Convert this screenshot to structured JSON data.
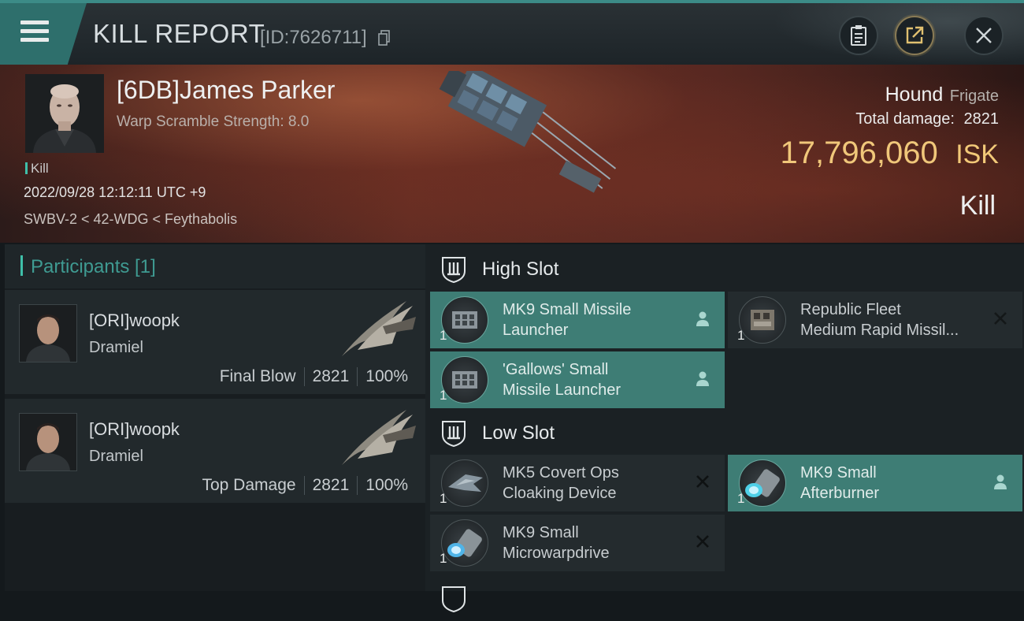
{
  "header": {
    "title": "KILL REPORT",
    "report_id": "[ID:7626711]"
  },
  "victim": {
    "name": "[6DB]James Parker",
    "warp_scramble": "Warp Scramble Strength: 8.0",
    "tag": "Kill",
    "datetime": "2022/09/28 12:12:11 UTC +9",
    "location": "SWBV-2 < 42-WDG < Feythabolis",
    "ship_name": "Hound",
    "ship_class": "Frigate",
    "damage_label": "Total damage:",
    "damage_value": "2821",
    "isk_value": "17,796,060",
    "isk_unit": "ISK",
    "result": "Kill"
  },
  "participants": {
    "heading": "Participants [1]",
    "rows": [
      {
        "name": "[ORI]woopk",
        "ship": "Dramiel",
        "role": "Final Blow",
        "damage": "2821",
        "percent": "100%"
      },
      {
        "name": "[ORI]woopk",
        "ship": "Dramiel",
        "role": "Top Damage",
        "damage": "2821",
        "percent": "100%"
      }
    ]
  },
  "slots": {
    "high": {
      "label": "High Slot",
      "items": [
        {
          "line1": "MK9 Small Missile",
          "line2": "Launcher",
          "qty": "1",
          "status": "owned"
        },
        {
          "line1": "Republic Fleet",
          "line2": "Medium Rapid Missil...",
          "qty": "1",
          "status": "destroyed"
        },
        {
          "line1": "'Gallows' Small",
          "line2": "Missile Launcher",
          "qty": "1",
          "status": "owned"
        }
      ]
    },
    "low": {
      "label": "Low Slot",
      "items": [
        {
          "line1": "MK5 Covert Ops",
          "line2": "Cloaking Device",
          "qty": "1",
          "status": "destroyed"
        },
        {
          "line1": "MK9 Small",
          "line2": "Afterburner",
          "qty": "1",
          "status": "owned"
        },
        {
          "line1": "MK9 Small",
          "line2": "Microwarpdrive",
          "qty": "1",
          "status": "destroyed"
        }
      ]
    }
  },
  "colors": {
    "accent": "#3fbfa9",
    "owned_item_bg": "#3e7d75",
    "isk_gold": "#f0c77a"
  },
  "icons": {
    "menu": "hamburger-menu-icon",
    "copy": "copy-icon",
    "clipboard": "clipboard-icon",
    "share": "share-icon",
    "close": "close-icon",
    "slot": "slot-icon",
    "owned": "person-icon",
    "destroyed": "x-icon"
  }
}
